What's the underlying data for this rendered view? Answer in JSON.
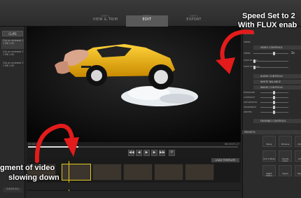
{
  "steps": [
    {
      "num": "STEP 1",
      "label": "VIEW & TRIM"
    },
    {
      "num": "STEP 2",
      "label": "EDIT"
    },
    {
      "num": "STEP 3",
      "label": "EXPORT"
    }
  ],
  "left": {
    "clips_button": "CLIPS",
    "clips": [
      {
        "title": "Clip as reviewed 1",
        "size": "1 MB",
        "date": "1:00"
      },
      {
        "title": "Clip as reviewed 2",
        "size": "1 MB",
        "date": "1:00"
      },
      {
        "title": "Clip as reviewed 3",
        "size": "1 MB",
        "date": "1:00"
      }
    ],
    "clear_all": "CLEAR ALL"
  },
  "video": {
    "time_start": "00:00:00.0",
    "time_end": "00:00:07.27"
  },
  "filmstrip": {
    "label": "LOAD TEMPLATE"
  },
  "right": {
    "playback": "PLAYBACK",
    "speed_header": "SPEED",
    "video_controls": "VIDEO CONTROLS",
    "speed_label": "SPEED",
    "speed_value": "2x",
    "fade_in": "FADE IN (sec)",
    "fade_out": "FADE OUT (sec)",
    "audio_controls": "AUDIO CONTROLS",
    "white_balance": "WHITE BALANCE",
    "image_controls": "IMAGE CONTROLS",
    "exposure": "EXPOSURE",
    "contrast": "CONTRAST",
    "saturation": "SATURATION",
    "sharpness": "SHARPNESS",
    "whites": "WHITES",
    "framing_controls": "FRAMING CONTROLS",
    "presets_header": "PRESETS",
    "presets": [
      "None",
      "Protune",
      "Vintage",
      "Cut a Wide",
      "Candy Color",
      "Action",
      "Night Vision",
      "Sepia",
      "Sky Wlt"
    ]
  },
  "annotations": {
    "top_line1": "Speed Set to 2",
    "top_line2": "With FLUX enab",
    "bottom_line1": "gment of video",
    "bottom_line2": "slowing down"
  },
  "colors": {
    "arrow": "#e31b1b",
    "car": "#f2b511",
    "playhead": "#e2c820"
  }
}
